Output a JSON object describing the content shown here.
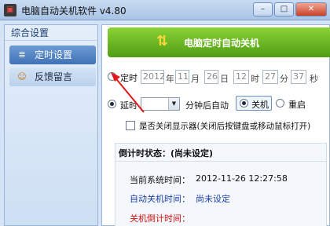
{
  "window": {
    "title": "电脑自动关机软件 v4.80",
    "controls": {
      "minimize": "–",
      "maximize": "□",
      "close": "✕"
    },
    "app_icon": "▣"
  },
  "sidebar": {
    "header": "综合设置",
    "items": [
      {
        "label": "定时设置",
        "icon": "≣"
      },
      {
        "label": "反馈留言",
        "icon": "☺"
      }
    ]
  },
  "banner": {
    "title": "电脑定时自动关机",
    "icon": "⇅"
  },
  "timed": {
    "label": "定时",
    "year": "2012",
    "year_unit": "年",
    "month": "11",
    "month_unit": "月",
    "day": "26",
    "day_unit": "日",
    "hour": "12",
    "hour_unit": "时",
    "minute": "27",
    "minute_unit": "分",
    "second": "37",
    "second_unit": "秒"
  },
  "delay": {
    "label": "延时",
    "minutes_value": "",
    "after_text": "分钟后自动",
    "opt_shutdown": "关机",
    "opt_restart": "重启"
  },
  "display_off": {
    "label": "是否关闭显示器(关闭后按键盘或移动鼠标打开)"
  },
  "status": {
    "header": "倒计时状态：(尚未设定)",
    "current_time_label": "当前系统时间：",
    "current_time_value": "2012-11-26 12:27:58",
    "auto_shutdown_label": "自动关机时间：",
    "auto_shutdown_value": "尚未设定",
    "countdown_label": "关机倒计时间："
  },
  "colors": {
    "accent_blue": "#1a3fa8",
    "warning_red": "#cc1111",
    "banner_green": "#6bb824"
  }
}
